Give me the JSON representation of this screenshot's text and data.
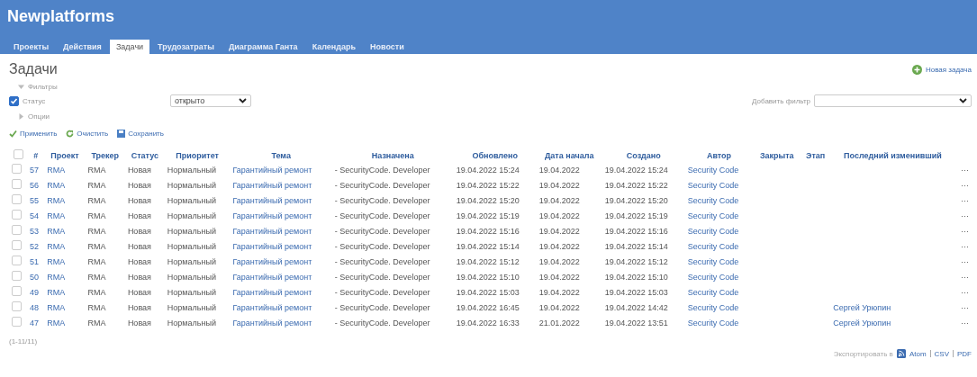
{
  "header": {
    "title": "Newplatforms"
  },
  "tabs": [
    {
      "label": "Проекты",
      "selected": false
    },
    {
      "label": "Действия",
      "selected": false
    },
    {
      "label": "Задачи",
      "selected": true
    },
    {
      "label": "Трудозатраты",
      "selected": false
    },
    {
      "label": "Диаграмма Ганта",
      "selected": false
    },
    {
      "label": "Календарь",
      "selected": false
    },
    {
      "label": "Новости",
      "selected": false
    }
  ],
  "page_title": "Задачи",
  "new_issue_link": "Новая задача",
  "filters": {
    "label": "Фильтры",
    "expanded": true,
    "status_filter": {
      "label": "Статус",
      "checked": true,
      "value": "открыто"
    },
    "add_filter": {
      "label": "Добавить фильтр"
    }
  },
  "options": {
    "label": "Опции",
    "expanded": false
  },
  "actions": [
    "Применить",
    "Очистить",
    "Сохранить"
  ],
  "table": {
    "select_all_checked": false,
    "columns": [
      "#",
      "Проект",
      "Трекер",
      "Статус",
      "Приоритет",
      "Тема",
      "Назначена",
      "Обновлено",
      "Дата начала",
      "Создано",
      "Автор",
      "Закрыта",
      "Этап",
      "Последний изменивший"
    ],
    "rows": [
      {
        "checked": false,
        "id": "57",
        "project": "RMA",
        "tracker": "RMA",
        "status": "Новая",
        "priority": "Нормальный",
        "subject": "Гарантийный ремонт",
        "assignee": "- SecurityCode. Developer",
        "updated": "19.04.2022 15:24",
        "start": "19.04.2022",
        "created": "19.04.2022 15:24",
        "author": "Security Code",
        "menu": "···"
      },
      {
        "checked": false,
        "id": "56",
        "project": "RMA",
        "tracker": "RMA",
        "status": "Новая",
        "priority": "Нормальный",
        "subject": "Гарантийный ремонт",
        "assignee": "- SecurityCode. Developer",
        "updated": "19.04.2022 15:22",
        "start": "19.04.2022",
        "created": "19.04.2022 15:22",
        "author": "Security Code",
        "menu": "···"
      },
      {
        "checked": false,
        "id": "55",
        "project": "RMA",
        "tracker": "RMA",
        "status": "Новая",
        "priority": "Нормальный",
        "subject": "Гарантийный ремонт",
        "assignee": "- SecurityCode. Developer",
        "updated": "19.04.2022 15:20",
        "start": "19.04.2022",
        "created": "19.04.2022 15:20",
        "author": "Security Code",
        "menu": "···"
      },
      {
        "checked": false,
        "id": "54",
        "project": "RMA",
        "tracker": "RMA",
        "status": "Новая",
        "priority": "Нормальный",
        "subject": "Гарантийный ремонт",
        "assignee": "- SecurityCode. Developer",
        "updated": "19.04.2022 15:19",
        "start": "19.04.2022",
        "created": "19.04.2022 15:19",
        "author": "Security Code",
        "menu": "···"
      },
      {
        "checked": false,
        "id": "53",
        "project": "RMA",
        "tracker": "RMA",
        "status": "Новая",
        "priority": "Нормальный",
        "subject": "Гарантийный ремонт",
        "assignee": "- SecurityCode. Developer",
        "updated": "19.04.2022 15:16",
        "start": "19.04.2022",
        "created": "19.04.2022 15:16",
        "author": "Security Code",
        "menu": "···"
      },
      {
        "checked": false,
        "id": "52",
        "project": "RMA",
        "tracker": "RMA",
        "status": "Новая",
        "priority": "Нормальный",
        "subject": "Гарантийный ремонт",
        "assignee": "- SecurityCode. Developer",
        "updated": "19.04.2022 15:14",
        "start": "19.04.2022",
        "created": "19.04.2022 15:14",
        "author": "Security Code",
        "menu": "···"
      },
      {
        "checked": false,
        "id": "51",
        "project": "RMA",
        "tracker": "RMA",
        "status": "Новая",
        "priority": "Нормальный",
        "subject": "Гарантийный ремонт",
        "assignee": "- SecurityCode. Developer",
        "updated": "19.04.2022 15:12",
        "start": "19.04.2022",
        "created": "19.04.2022 15:12",
        "author": "Security Code",
        "menu": "···"
      },
      {
        "checked": false,
        "id": "50",
        "project": "RMA",
        "tracker": "RMA",
        "status": "Новая",
        "priority": "Нормальный",
        "subject": "Гарантийный ремонт",
        "assignee": "- SecurityCode. Developer",
        "updated": "19.04.2022 15:10",
        "start": "19.04.2022",
        "created": "19.04.2022 15:10",
        "author": "Security Code",
        "menu": "···"
      },
      {
        "checked": false,
        "id": "49",
        "project": "RMA",
        "tracker": "RMA",
        "status": "Новая",
        "priority": "Нормальный",
        "subject": "Гарантийный ремонт",
        "assignee": "- SecurityCode. Developer",
        "updated": "19.04.2022 15:03",
        "start": "19.04.2022",
        "created": "19.04.2022 15:03",
        "author": "Security Code",
        "menu": "···"
      },
      {
        "checked": false,
        "id": "48",
        "project": "RMA",
        "tracker": "RMA",
        "status": "Новая",
        "priority": "Нормальный",
        "subject": "Гарантийный ремонт",
        "assignee": "- SecurityCode. Developer",
        "updated": "19.04.2022 16:45",
        "start": "19.04.2022",
        "created": "19.04.2022 14:42",
        "author": "Security Code",
        "last_editor": "Сергей Урюпин",
        "menu": "···"
      },
      {
        "checked": false,
        "id": "47",
        "project": "RMA",
        "tracker": "RMA",
        "status": "Новая",
        "priority": "Нормальный",
        "subject": "Гарантийный ремонт",
        "assignee": "- SecurityCode. Developer",
        "updated": "19.04.2022 16:33",
        "start": "21.01.2022",
        "created": "19.04.2022 13:51",
        "author": "Security Code",
        "last_editor": "Сергей Урюпин",
        "menu": "···"
      }
    ]
  },
  "pagination": "(1-11/11)",
  "export": {
    "label": "Экспортировать в",
    "formats": [
      "Atom",
      "CSV",
      "PDF"
    ]
  }
}
